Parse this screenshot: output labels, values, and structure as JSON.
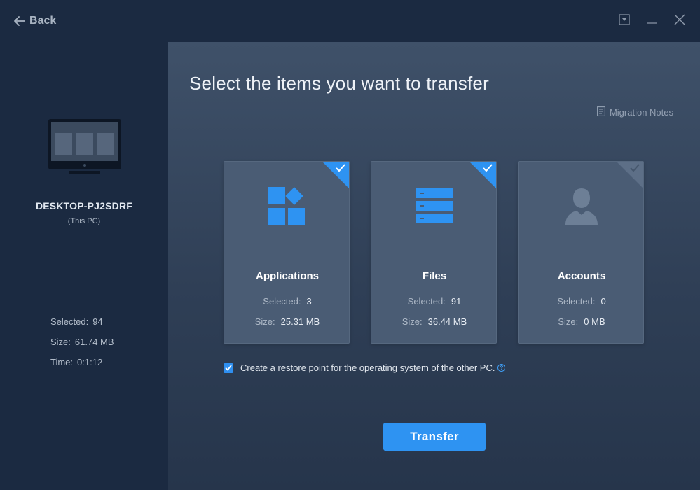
{
  "titlebar": {
    "back_label": "Back",
    "buttons": [
      "dropdown-icon",
      "minimize-icon",
      "close-icon"
    ]
  },
  "sidebar": {
    "pc_name": "DESKTOP-PJ2SDRF",
    "pc_sub": "(This PC)",
    "stats": [
      {
        "label": "Selected:",
        "value": "94"
      },
      {
        "label": "Size:",
        "value": "61.74 MB"
      },
      {
        "label": "Time:",
        "value": "0:1:12"
      }
    ]
  },
  "main": {
    "heading": "Select the items you want to transfer",
    "notes_label": "Migration Notes",
    "cards": [
      {
        "label": "Applications",
        "selected_label": "Selected:",
        "selected": "3",
        "size_label": "Size:",
        "size": "25.31 MB",
        "checked": true,
        "icon": "apps-grid-icon"
      },
      {
        "label": "Files",
        "selected_label": "Selected:",
        "selected": "91",
        "size_label": "Size:",
        "size": "36.44 MB",
        "checked": true,
        "icon": "files-stack-icon"
      },
      {
        "label": "Accounts",
        "selected_label": "Selected:",
        "selected": "0",
        "size_label": "Size:",
        "size": "0 MB",
        "checked": false,
        "icon": "user-account-icon"
      }
    ],
    "restore_label": "Create a restore point for the operating system of the other PC.",
    "restore_checked": true,
    "help_glyph": "?",
    "transfer_label": "Transfer"
  },
  "colors": {
    "accent": "#2e93f2",
    "sidebar_bg": "#1b2a41",
    "card_bg": "#4a5c74",
    "unchecked_corner": "#5d6f87"
  }
}
